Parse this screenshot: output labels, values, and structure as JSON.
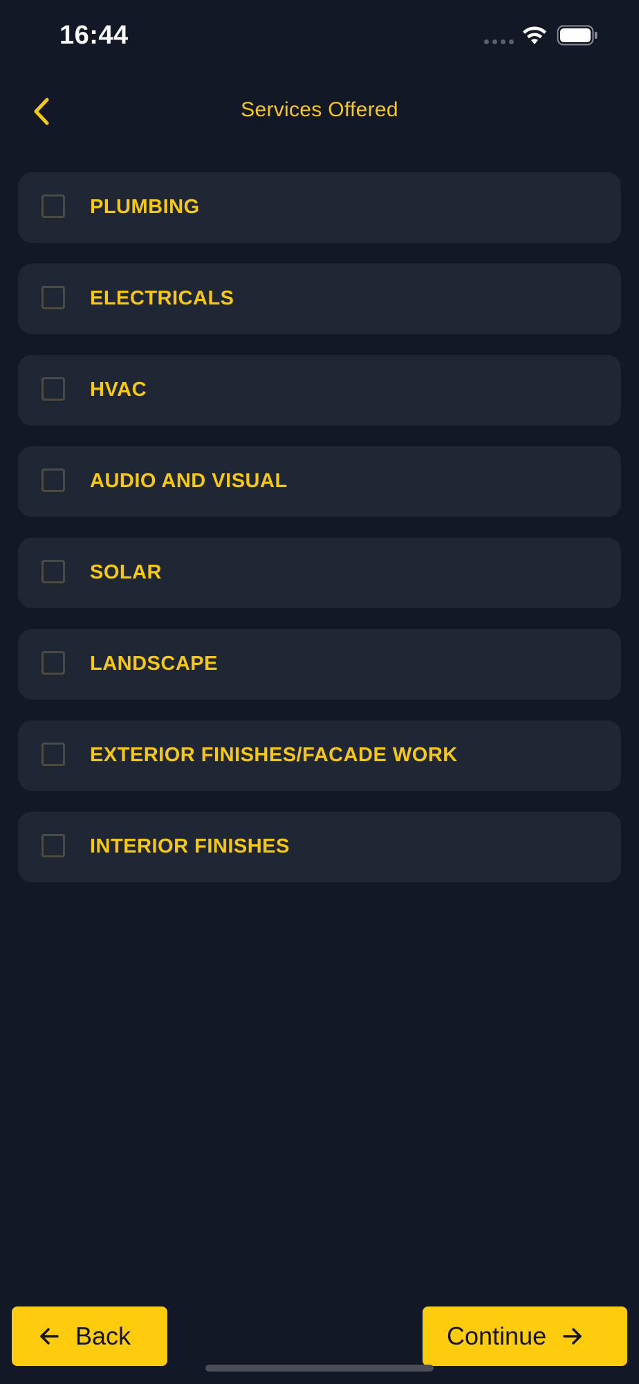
{
  "status_bar": {
    "time": "16:44"
  },
  "header": {
    "title": "Services Offered",
    "back_icon": "chevron-left-icon"
  },
  "services": [
    {
      "label": "PLUMBING",
      "checked": false
    },
    {
      "label": "ELECTRICALS",
      "checked": false
    },
    {
      "label": "HVAC",
      "checked": false
    },
    {
      "label": "AUDIO AND VISUAL",
      "checked": false
    },
    {
      "label": "SOLAR",
      "checked": false
    },
    {
      "label": "LANDSCAPE",
      "checked": false
    },
    {
      "label": "EXTERIOR FINISHES/FACADE WORK",
      "checked": false
    },
    {
      "label": "INTERIOR FINISHES",
      "checked": false
    }
  ],
  "footer": {
    "back_label": "Back",
    "back_icon": "arrow-left-icon",
    "continue_label": "Continue",
    "continue_icon": "arrow-right-icon"
  },
  "colors": {
    "background": "#131826",
    "card": "#1F2634",
    "accent": "#F6C90E",
    "button": "#FDCC0D"
  }
}
